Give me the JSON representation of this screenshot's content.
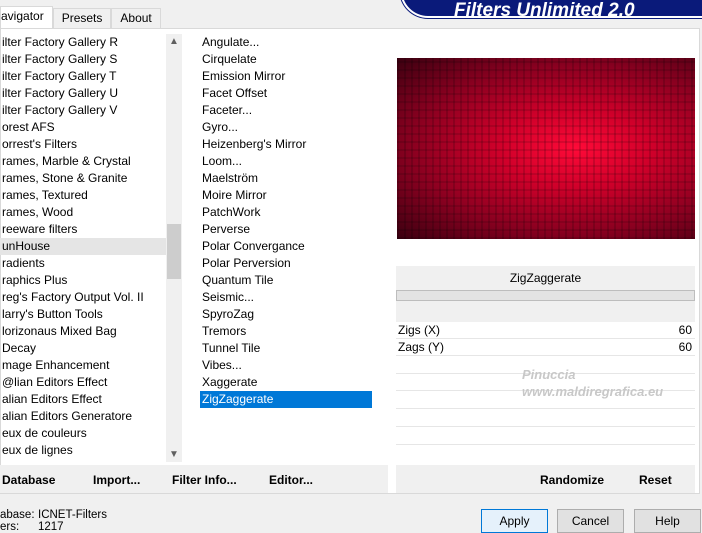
{
  "tabs": [
    "avigator",
    "Presets",
    "About"
  ],
  "banner": "Filters Unlimited 2.0",
  "categories": [
    "ilter Factory Gallery R",
    "ilter Factory Gallery S",
    "ilter Factory Gallery T",
    "ilter Factory Gallery U",
    "ilter Factory Gallery V",
    "orest AFS",
    "orrest's Filters",
    "rames, Marble & Crystal",
    "rames, Stone & Granite",
    "rames, Textured",
    "rames, Wood",
    "reeware filters",
    "unHouse",
    "radients",
    "raphics Plus",
    "reg's Factory Output Vol. II",
    "larry's Button Tools",
    "lorizonaus Mixed Bag",
    " Decay",
    "mage Enhancement",
    "@lian Editors Effect",
    "alian Editors Effect",
    "alian Editors Generatore",
    "eux de couleurs",
    "eux de lignes"
  ],
  "filters": [
    "Angulate...",
    "Cirquelate",
    "Emission Mirror",
    "Facet Offset",
    "Faceter...",
    "Gyro...",
    "Heizenberg's Mirror",
    "Loom...",
    "Maelström",
    "Moire Mirror",
    "PatchWork",
    "Perverse",
    "Polar Convergance",
    "Polar Perversion",
    "Quantum Tile",
    "Seismic...",
    "SpyroZag",
    "Tremors",
    "Tunnel Tile",
    "Vibes...",
    "Xaggerate",
    "ZigZaggerate"
  ],
  "filter_name": "ZigZaggerate",
  "params": [
    {
      "label": "Zigs (X)",
      "value": "60"
    },
    {
      "label": "Zags (Y)",
      "value": "60"
    }
  ],
  "watermark": {
    "line1": "Pinuccia",
    "line2": "www.maldiregrafica.eu"
  },
  "left_buttons": [
    "Database",
    "Import...",
    "Filter Info...",
    "Editor..."
  ],
  "right_buttons": [
    "Randomize",
    "Reset"
  ],
  "status": {
    "db_label": "abase:",
    "db_value": "ICNET-Filters",
    "count_label": "ers:",
    "count_value": "1217"
  },
  "dialog_buttons": [
    "Apply",
    "Cancel",
    "Help"
  ]
}
